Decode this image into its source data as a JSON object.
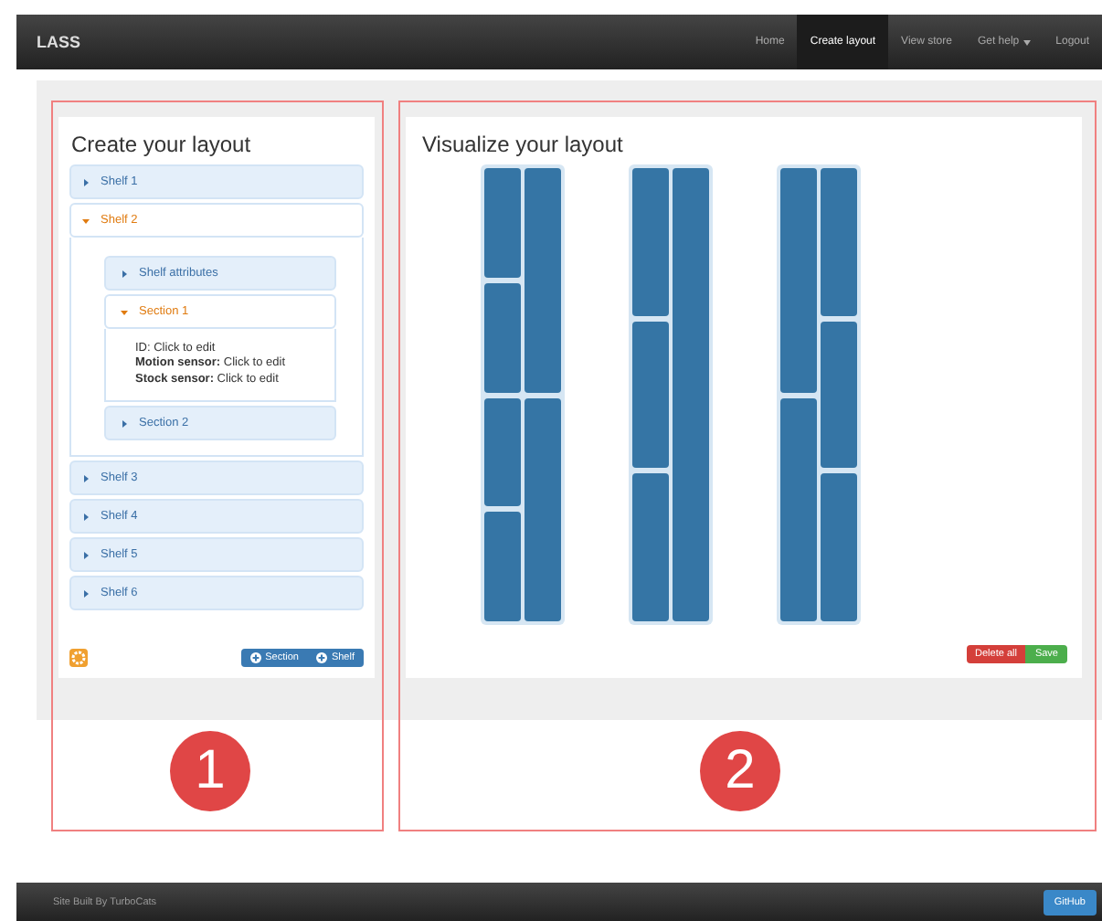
{
  "navbar": {
    "brand": "LASS",
    "items": [
      {
        "label": "Home",
        "selected": false,
        "dropdown": false
      },
      {
        "label": "Create layout",
        "selected": true,
        "dropdown": false
      },
      {
        "label": "View store",
        "selected": false,
        "dropdown": false
      },
      {
        "label": "Get help",
        "selected": false,
        "dropdown": true
      },
      {
        "label": "Logout",
        "selected": false,
        "dropdown": false
      }
    ]
  },
  "create_panel": {
    "title": "Create your layout",
    "shelves": [
      {
        "label": "Shelf 1",
        "expanded": false
      },
      {
        "label": "Shelf 2",
        "expanded": true,
        "children": [
          {
            "label": "Shelf attributes",
            "expanded": false
          },
          {
            "label": "Section 1",
            "expanded": true,
            "lines": [
              "ID: Click to edit",
              "**Motion sensor:** Click to edit",
              "**Stock sensor:** Click to edit"
            ]
          },
          {
            "label": "Section 2",
            "expanded": false
          }
        ]
      },
      {
        "label": "Shelf 3",
        "expanded": false
      },
      {
        "label": "Shelf 4",
        "expanded": false
      },
      {
        "label": "Shelf 5",
        "expanded": false
      },
      {
        "label": "Shelf 6",
        "expanded": false
      }
    ],
    "buttons": [
      {
        "label": "Section",
        "kind": "add"
      },
      {
        "label": "Shelf",
        "kind": "add"
      }
    ]
  },
  "visualize_panel": {
    "title": "Visualize your layout",
    "shelves": [
      {
        "columns": [
          {
            "sections": [
              {
                "kind": "block"
              },
              {
                "kind": "block"
              },
              {
                "kind": "block"
              },
              {
                "kind": "block"
              }
            ]
          },
          {
            "sections": [
              {
                "kind": "block"
              },
              {
                "kind": "block"
              }
            ]
          }
        ]
      },
      {
        "columns": [
          {
            "sections": [
              {
                "kind": "block"
              },
              {
                "kind": "block"
              },
              {
                "kind": "block"
              }
            ]
          },
          {
            "sections": [
              {
                "kind": "block"
              }
            ]
          }
        ]
      },
      {
        "columns": [
          {
            "sections": [
              {
                "kind": "block"
              },
              {
                "kind": "block"
              }
            ]
          },
          {
            "sections": [
              {
                "kind": "block"
              },
              {
                "kind": "block"
              },
              {
                "kind": "block"
              }
            ]
          }
        ]
      }
    ],
    "buttons": [
      {
        "label": "Delete all",
        "kind": "danger"
      },
      {
        "label": "Save",
        "kind": "success"
      }
    ]
  },
  "annotations": [
    "1",
    "2"
  ],
  "footer": {
    "text": "Site Built By TurboCats",
    "button": "GitHub"
  }
}
